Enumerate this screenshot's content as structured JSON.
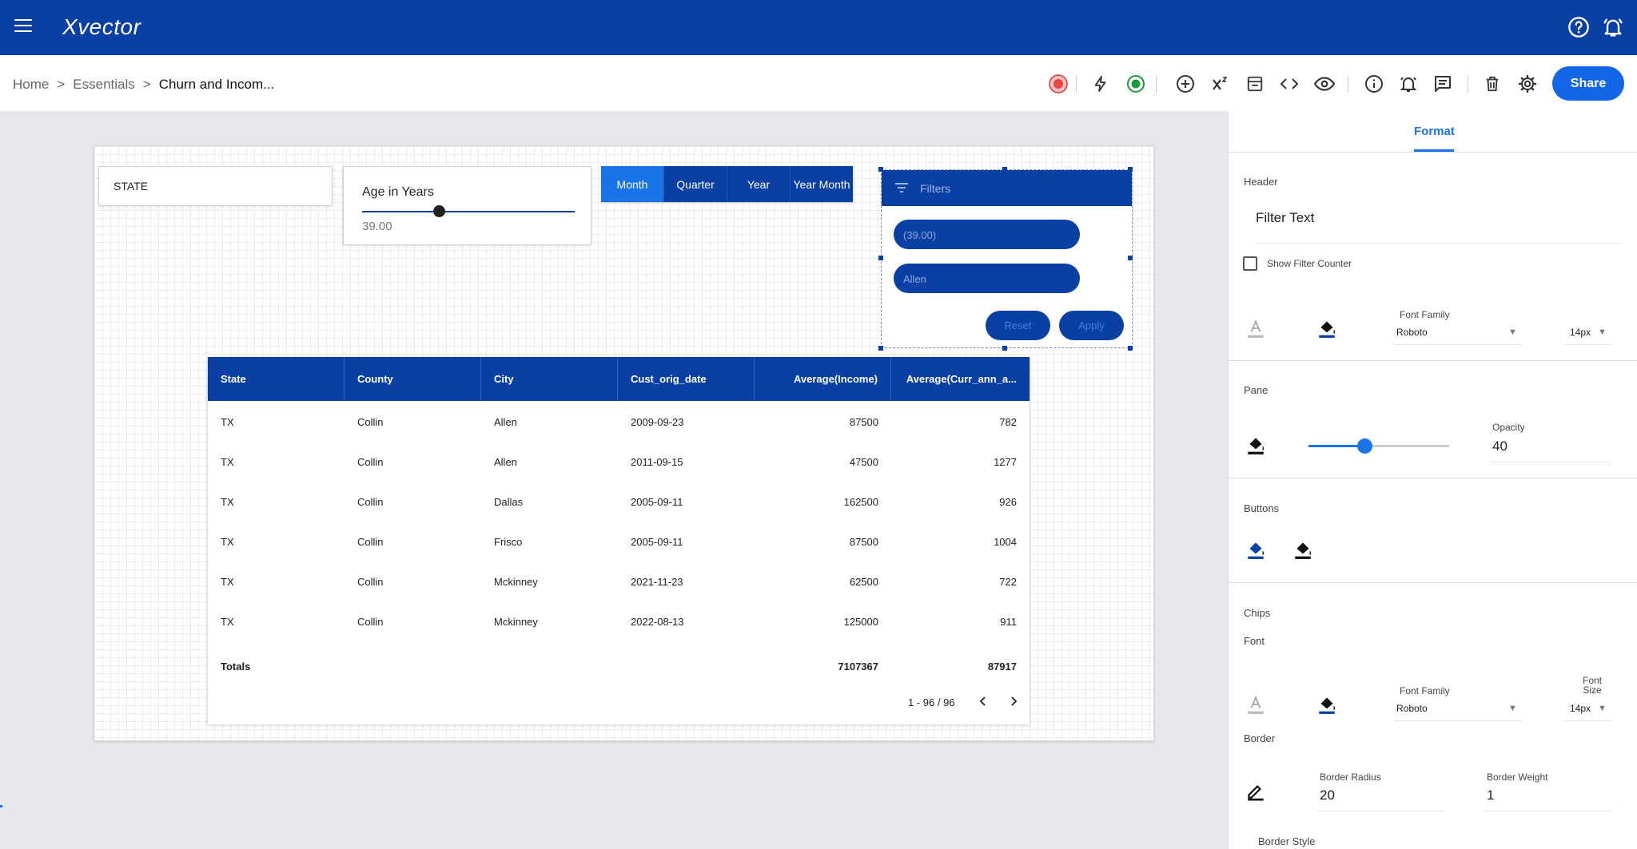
{
  "app": {
    "logo": "Xvector"
  },
  "breadcrumb": {
    "home": "Home",
    "sep": ">",
    "section": "Essentials",
    "current": "Churn and Incom..."
  },
  "toolbar": {
    "share_label": "Share"
  },
  "widgets": {
    "state_label": "STATE",
    "age": {
      "label": "Age in Years",
      "value": "39.00",
      "slider_fraction": 0.36
    },
    "segments": [
      {
        "label": "Month",
        "active": true
      },
      {
        "label": "Quarter",
        "active": false
      },
      {
        "label": "Year",
        "active": false
      },
      {
        "label": "Year Month",
        "active": false
      }
    ],
    "filters": {
      "title": "Filters",
      "chips": [
        "(39.00)",
        "Allen"
      ],
      "reset_label": "Reset",
      "apply_label": "Apply"
    }
  },
  "table": {
    "columns": [
      "State",
      "County",
      "City",
      "Cust_orig_date",
      "Average(Income)",
      "Average(Curr_ann_a..."
    ],
    "rows": [
      [
        "TX",
        "Collin",
        "Allen",
        "2009-09-23",
        "87500",
        "782"
      ],
      [
        "TX",
        "Collin",
        "Allen",
        "2011-09-15",
        "47500",
        "1277"
      ],
      [
        "TX",
        "Collin",
        "Dallas",
        "2005-09-11",
        "162500",
        "926"
      ],
      [
        "TX",
        "Collin",
        "Frisco",
        "2005-09-11",
        "87500",
        "1004"
      ],
      [
        "TX",
        "Collin",
        "Mckinney",
        "2021-11-23",
        "62500",
        "722"
      ],
      [
        "TX",
        "Collin",
        "Mckinney",
        "2022-08-13",
        "125000",
        "911"
      ]
    ],
    "totals": {
      "label": "Totals",
      "income": "7107367",
      "curr": "87917"
    },
    "pager": "1 - 96 / 96"
  },
  "panel": {
    "tab": "Format",
    "header": {
      "title": "Header",
      "filter_text": "Filter Text",
      "show_counter_label": "Show Filter Counter",
      "font_family_label": "Font Family",
      "font_family": "Roboto",
      "font_size": "14px"
    },
    "pane": {
      "title": "Pane",
      "opacity_label": "Opacity",
      "opacity": "40"
    },
    "buttons": {
      "title": "Buttons"
    },
    "chips": {
      "title": "Chips",
      "font_label": "Font",
      "font_family_label": "Font Family",
      "font_family": "Roboto",
      "font_size_label": "Font Size",
      "font_size": "14px",
      "border_label": "Border",
      "border_radius_label": "Border Radius",
      "border_radius": "20",
      "border_weight_label": "Border Weight",
      "border_weight": "1",
      "border_style_label": "Border Style"
    }
  },
  "colors": {
    "brand": "#0a3fa3",
    "accent": "#1a73e8",
    "canvas_bg": "#e6e8ec"
  }
}
